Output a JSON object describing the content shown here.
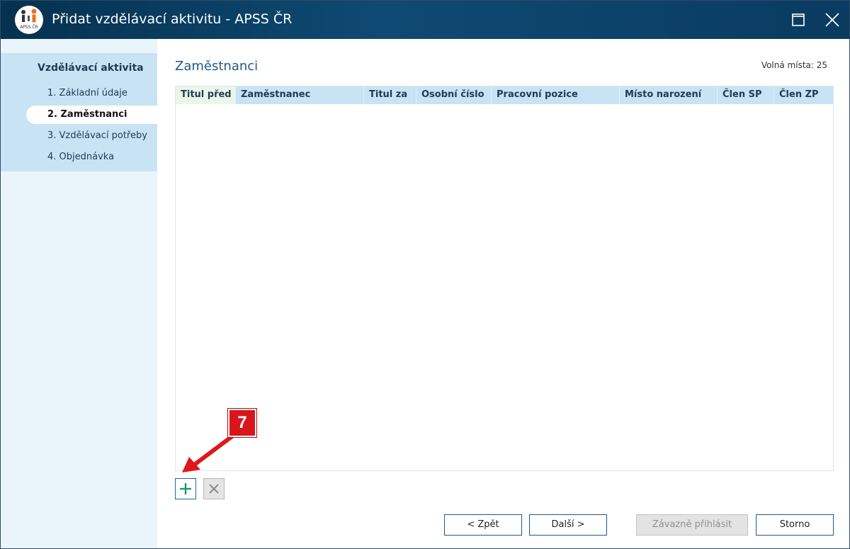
{
  "window": {
    "title": "Přidat vzdělávací aktivitu - APSS ČR",
    "logo_text": "APSS ČR",
    "maximize_icon": "maximize-icon",
    "close_icon": "close-icon"
  },
  "sidebar": {
    "heading": "Vzdělávací aktivita",
    "items": [
      {
        "label": "1. Základní údaje",
        "active": false
      },
      {
        "label": "2. Zaměstnanci",
        "active": true
      },
      {
        "label": "3. Vzdělávací potřeby",
        "active": false
      },
      {
        "label": "4. Objednávka",
        "active": false
      }
    ]
  },
  "main": {
    "title": "Zaměstnanci",
    "seats_label": "Volná místa: 25",
    "table": {
      "columns": [
        "Titul před",
        "Zaměstnanec",
        "Titul za",
        "Osobní číslo",
        "Pracovní pozice",
        "Místo narození",
        "Člen SP",
        "Člen ZP"
      ],
      "rows": []
    },
    "add_icon": "plus-icon",
    "delete_icon": "x-icon"
  },
  "callout": {
    "number": "7"
  },
  "buttons": {
    "back": "< Zpět",
    "next": "Další >",
    "register": "Závazně přihlásit",
    "cancel": "Storno"
  },
  "colors": {
    "titlebar": "#0a3b60",
    "accent": "#1e5a8a",
    "sidebar_panel": "#c8e3f3",
    "sidebar_bg": "#e9f4fb",
    "callout_red": "#d9161c",
    "add_green": "#1a9a72"
  }
}
